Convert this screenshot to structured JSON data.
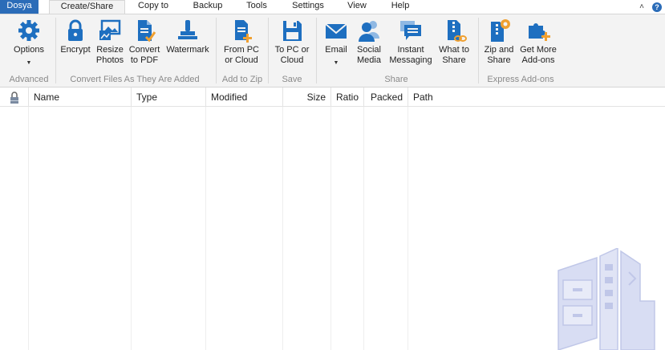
{
  "menu": {
    "file": "Dosya",
    "tabs": [
      "Create/Share",
      "Copy to",
      "Backup",
      "Tools",
      "Settings",
      "View",
      "Help"
    ]
  },
  "ribbon": {
    "buttons": {
      "options": "Options",
      "encrypt": "Encrypt",
      "resize": "Resize\nPhotos",
      "convert": "Convert\nto PDF",
      "watermark": "Watermark",
      "from_pc": "From PC\nor Cloud",
      "to_pc": "To PC or\nCloud",
      "email": "Email",
      "social": "Social\nMedia",
      "instant": "Instant\nMessaging",
      "whatto": "What to\nShare",
      "zipshare": "Zip and\nShare",
      "getmore": "Get More\nAdd-ons"
    },
    "groups": {
      "advanced": "Advanced",
      "convert": "Convert Files As They Are Added",
      "addzip": "Add to Zip",
      "save": "Save",
      "share": "Share",
      "express": "Express Add-ons"
    }
  },
  "columns": [
    "Name",
    "Type",
    "Modified",
    "Size",
    "Ratio",
    "Packed",
    "Path"
  ],
  "colors": {
    "accent": "#2b6cb8",
    "icon_blue": "#1e6fc0",
    "icon_orange": "#f0a030"
  }
}
